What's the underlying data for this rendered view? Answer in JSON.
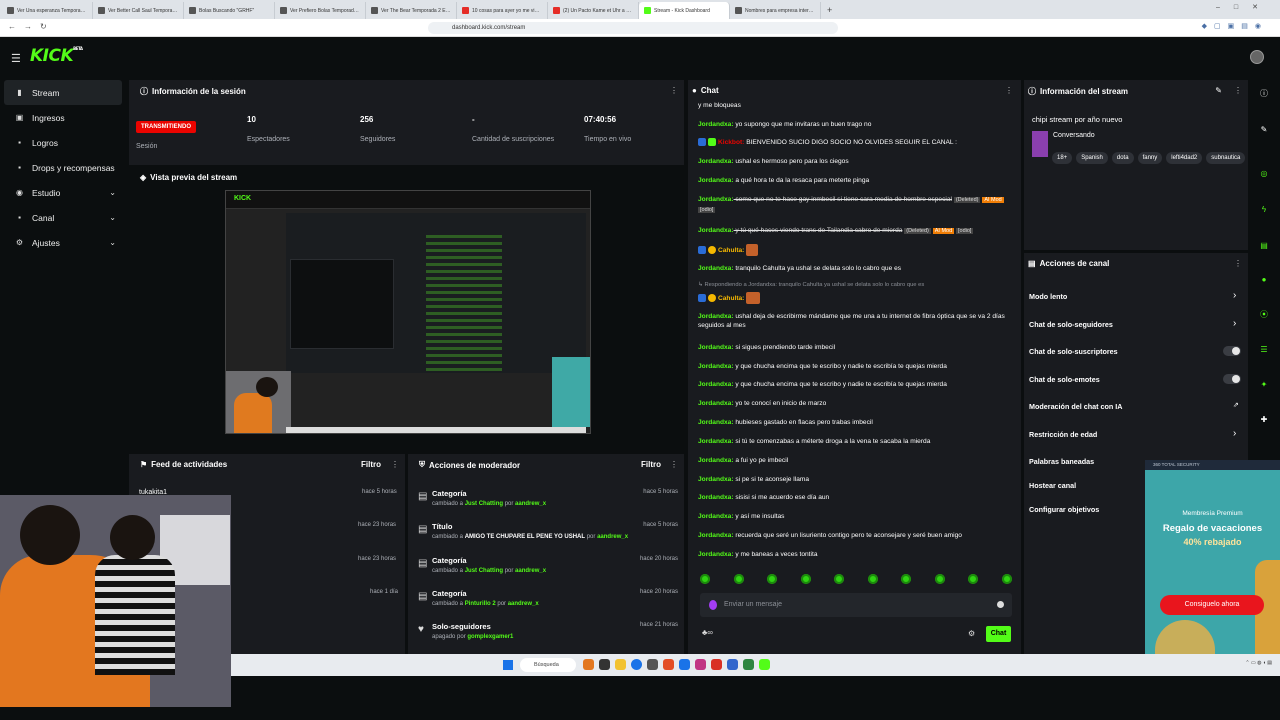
{
  "browser": {
    "tabs": [
      {
        "label": "Ver Una esperanza Temporada 5 Ep..."
      },
      {
        "label": "Ver Better Call Saul Temporada 2 Ep..."
      },
      {
        "label": "Bolas Buscando \"GRHF\""
      },
      {
        "label": "Ver Prefiero Bolas Temporada 2 Episo..."
      },
      {
        "label": "Ver The Bear Temporada 2 Episodio..."
      },
      {
        "label": "10 cosas para ayer yo me vine dentro..."
      },
      {
        "label": "(2) Un Pacto Kame et Uhr a N..."
      },
      {
        "label": "Stream - Kick Dashboard"
      },
      {
        "label": "Nombres para empresa internet"
      }
    ],
    "new_tab": "+",
    "url": "dashboard.kick.com/stream"
  },
  "header": {
    "logo": "KICK",
    "logo_sup": "BETA"
  },
  "sidebar": {
    "items": [
      {
        "label": "Stream"
      },
      {
        "label": "Ingresos"
      },
      {
        "label": "Logros"
      },
      {
        "label": "Drops y recompensas"
      },
      {
        "label": "Estudio"
      },
      {
        "label": "Canal"
      },
      {
        "label": "Ajustes"
      }
    ]
  },
  "session": {
    "title": "Información de la sesión",
    "status": "TRANSMITIENDO",
    "status_label": "Sesión",
    "viewers": "10",
    "viewers_label": "Espectadores",
    "followers": "256",
    "followers_label": "Seguidores",
    "subs": "-",
    "subs_label": "Cantidad de suscripciones",
    "uptime": "07:40:56",
    "uptime_label": "Tiempo en vivo"
  },
  "preview": {
    "title": "Vista previa del stream"
  },
  "activity": {
    "title": "Feed de actividades",
    "filter": "Filtro",
    "items": [
      {
        "user": "tukakita1",
        "time": "hace 5 horas"
      },
      {
        "user": "",
        "time": "hace 23 horas"
      },
      {
        "user": "",
        "time": "hace 23 horas"
      },
      {
        "user": "",
        "time": "hace 1 día"
      }
    ]
  },
  "modactions": {
    "title": "Acciones de moderador",
    "filter": "Filtro",
    "items": [
      {
        "title": "Categoría",
        "pre": "cambiado a ",
        "value": "Just Chatting",
        "mid": " por ",
        "by": "aandrew_x",
        "time": "hace 5 horas"
      },
      {
        "title": "Título",
        "pre": "cambiado a ",
        "value": "AMIGO TE CHUPARE EL PENE YO USHAL",
        "mid": " por ",
        "by": "aandrew_x",
        "time": "hace 5 horas"
      },
      {
        "title": "Categoría",
        "pre": "cambiado a ",
        "value": "Just Chatting",
        "mid": " por ",
        "by": "aandrew_x",
        "time": "hace 20 horas"
      },
      {
        "title": "Categoría",
        "pre": "cambiado a ",
        "value": "Pinturillo 2",
        "mid": " por ",
        "by": "aandrew_x",
        "time": "hace 20 horas"
      },
      {
        "title": "Solo-seguidores",
        "pre": "apagado por ",
        "value": "",
        "mid": "",
        "by": "gomplexgamer1",
        "time": "hace 21 horas"
      }
    ]
  },
  "chat": {
    "title": "Chat",
    "messages": [
      {
        "user": "",
        "text": "y me bloqueas"
      },
      {
        "user": "Jordandxa:",
        "text": " yo supongo que me invitaras un buen trago no"
      },
      {
        "user": "Kickbot:",
        "text": " BIENVENIDO SUCIO DIGO SOCIO NO OLVIDES SEGUIR EL CANAL :"
      },
      {
        "user": "Jordandxa:",
        "text": " ushal es hermoso pero para los ciegos"
      },
      {
        "user": "Jordandxa:",
        "text": " a qué hora te da la resaca para meterte pinga"
      },
      {
        "user": "Jordandxa:",
        "text": " como que no te hace gay inmbecil si tiene cara media de hombre especial"
      },
      {
        "user": "Jordandxa:",
        "text": " y tú qué haces viendo trans de Tailandia cabro de mierda"
      },
      {
        "user": "Cahulta:",
        "text": ""
      },
      {
        "user": "Jordandxa:",
        "text": " tranquilo Cahulta ya ushal se delata solo lo cabro que es"
      },
      {
        "user": "",
        "text": "Respondiendo a Jordandxa: tranquilo Cahulta ya ushal se delata solo lo cabro que es"
      },
      {
        "user": "Cahulta:",
        "text": ""
      },
      {
        "user": "Jordandxa:",
        "text": " ushal deja de escribirme mándame que me una a tu internet de fibra óptica que se va 2 días seguidos al mes"
      },
      {
        "user": "Jordandxa:",
        "text": " si sigues prendiendo tarde imbecil"
      },
      {
        "user": "Jordandxa:",
        "text": " y que chucha encima que te escribo y nadie te escribía te quejas mierda"
      },
      {
        "user": "Jordandxa:",
        "text": " y que chucha encima que te escribo y nadie te escribía te quejas mierda"
      },
      {
        "user": "Jordandxa:",
        "text": " yo te conocí en inicio de marzo"
      },
      {
        "user": "Jordandxa:",
        "text": " hubieses gastado en flacas pero trabas imbecil"
      },
      {
        "user": "Jordandxa:",
        "text": " si tú te comenzabas a méterte droga a la vena te sacaba la mierda"
      },
      {
        "user": "Jordandxa:",
        "text": " a fui yo pe imbecil"
      },
      {
        "user": "Jordandxa:",
        "text": " si pe si te aconseje llama"
      },
      {
        "user": "Jordandxa:",
        "text": " sisisi si me acuerdo ese día aun"
      },
      {
        "user": "Jordandxa:",
        "text": " y así me insultas"
      },
      {
        "user": "Jordandxa:",
        "text": " recuerda que seré un lisuriento contigo pero te aconsejare y seré buen amigo"
      },
      {
        "user": "Jordandxa:",
        "text": " y me baneas a veces tontita"
      }
    ],
    "tag_deleted": "(Deleted)",
    "tag_aimod": "AI Mod",
    "tag_odio": "[odio]",
    "input_placeholder": "Enviar un mensaje",
    "send_label": "Chat"
  },
  "streaminfo": {
    "title": "Información del stream",
    "stream_title": "chipi stream por año nuevo",
    "category": "Conversando",
    "tags": [
      "18+",
      "Spanish",
      "dota",
      "fanny",
      "lefti4dad2",
      "subnautica"
    ]
  },
  "channelactions": {
    "title": "Acciones de canal",
    "items": [
      {
        "label": "Modo lento",
        "ctl": "chevron"
      },
      {
        "label": "Chat de solo-seguidores",
        "ctl": "chevron"
      },
      {
        "label": "Chat de solo-suscriptores",
        "ctl": "toggle"
      },
      {
        "label": "Chat de solo-emotes",
        "ctl": "toggle"
      },
      {
        "label": "Moderación del chat con IA",
        "ctl": "external"
      },
      {
        "label": "Restricción de edad",
        "ctl": "chevron"
      },
      {
        "label": "Palabras baneadas",
        "ctl": "none"
      },
      {
        "label": "Hostear canal",
        "ctl": "none"
      },
      {
        "label": "Configurar objetivos",
        "ctl": "none"
      }
    ]
  },
  "ad": {
    "security": "360 TOTAL SECURITY",
    "line1": "Membresía Premium",
    "line2": "Regalo de vacaciones",
    "line3": "40% rebajado",
    "cta": "Consiguelo ahora"
  },
  "taskbar": {
    "search": "Búsqueda"
  },
  "colors": {
    "accent": "#53fc18",
    "live": "#eb0400",
    "panel": "#191b1f",
    "background": "#0b0e0f"
  }
}
